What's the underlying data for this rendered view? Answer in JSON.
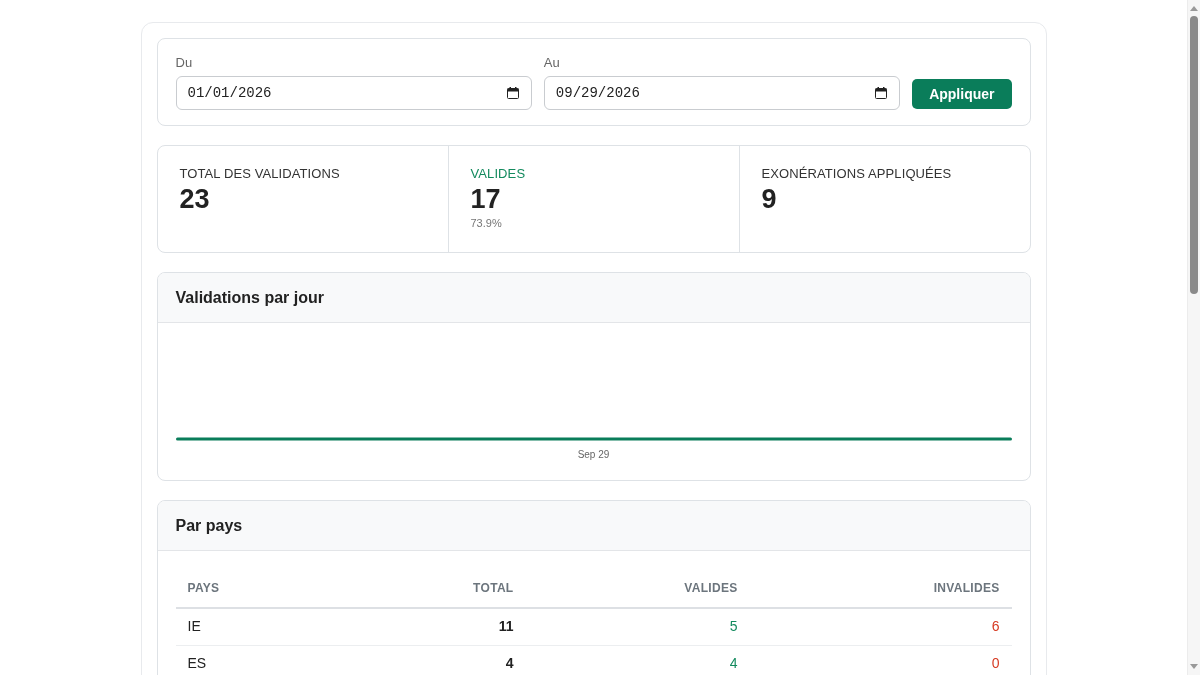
{
  "filters": {
    "fields": [
      {
        "label": "Du",
        "value": "01/01/2026"
      },
      {
        "label": "Au",
        "value": "09/29/2026"
      }
    ],
    "apply_button": "Appliquer"
  },
  "stats": [
    {
      "label": "TOTAL DES VALIDATIONS",
      "value": "23",
      "kind": "plain"
    },
    {
      "label": "VALIDES",
      "value": "17",
      "note": "73.9%",
      "kind": "valid"
    },
    {
      "label": "EXONÉRATIONS APPLIQUÉES",
      "value": "9",
      "kind": "plain"
    }
  ],
  "daily_chart": {
    "title": "Validations par jour",
    "x_label": "Sep 29"
  },
  "by_country": {
    "title": "Par pays",
    "columns": [
      "PAYS",
      "TOTAL",
      "VALIDES",
      "INVALIDES"
    ],
    "rows": [
      [
        "IE",
        "11",
        "5",
        "6"
      ],
      [
        "ES",
        "4",
        "4",
        "0"
      ]
    ]
  }
}
